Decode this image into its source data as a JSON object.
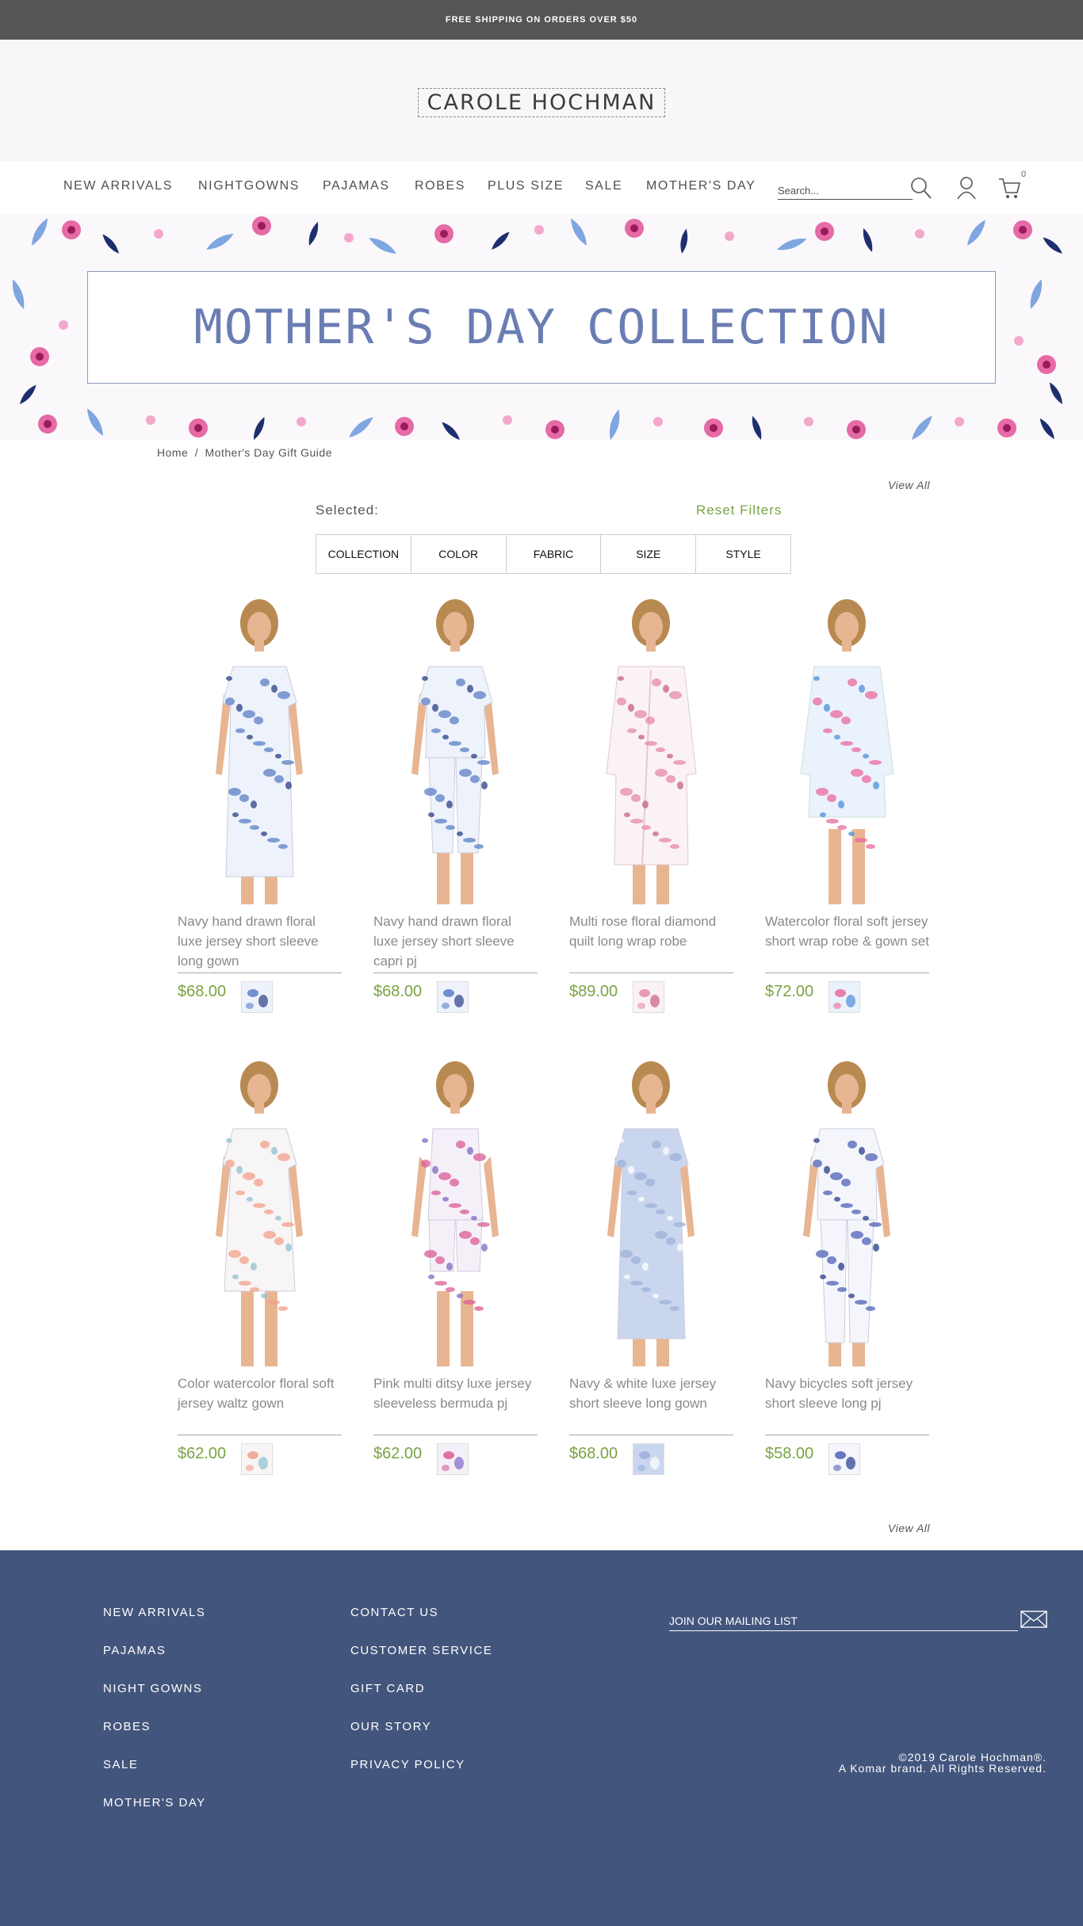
{
  "announcement": "FREE SHIPPING ON ORDERS OVER $50",
  "brand": {
    "logo_text": "CAROLE HOCHMAN"
  },
  "nav": {
    "items": [
      "NEW ARRIVALS",
      "NIGHTGOWNS",
      "PAJAMAS",
      "ROBES",
      "PLUS SIZE",
      "SALE",
      "MOTHER'S DAY"
    ],
    "search_placeholder": "Search...",
    "cart_count": "0"
  },
  "hero": {
    "title": "MOTHER'S DAY COLLECTION"
  },
  "breadcrumb": {
    "home": "Home",
    "separator": "/",
    "current": "Mother's Day Gift Guide"
  },
  "listing": {
    "view_all": "View All",
    "selected_label": "Selected:",
    "reset_filters": "Reset Filters",
    "filters": [
      "COLLECTION",
      "COLOR",
      "FABRIC",
      "SIZE",
      "STYLE"
    ]
  },
  "products": [
    {
      "name": "Navy hand drawn floral luxe jersey short sleeve long gown",
      "price": "$68.00",
      "style": "long gown",
      "print": "blue floral"
    },
    {
      "name": "Navy hand drawn floral luxe jersey short sleeve capri pj",
      "price": "$68.00",
      "style": "capri pj",
      "print": "blue floral"
    },
    {
      "name": "Multi rose floral diamond quilt long wrap robe",
      "price": "$89.00",
      "style": "long robe",
      "print": "pink floral"
    },
    {
      "name": "Watercolor floral soft jersey short wrap robe & gown set",
      "price": "$72.00",
      "style": "short robe",
      "print": "blue pink watercolor"
    },
    {
      "name": "Color watercolor floral soft jersey waltz gown",
      "price": "$62.00",
      "style": "waltz gown",
      "print": "coral watercolor"
    },
    {
      "name": "Pink multi ditsy luxe jersey sleeveless bermuda pj",
      "price": "$62.00",
      "style": "bermuda pj",
      "print": "pink ditsy"
    },
    {
      "name": "Navy & white luxe jersey short sleeve long gown",
      "price": "$68.00",
      "style": "long gown",
      "print": "light blue stripe"
    },
    {
      "name": "Navy bicycles soft jersey short sleeve long pj",
      "price": "$58.00",
      "style": "long pj",
      "print": "navy bicycles"
    }
  ],
  "footer": {
    "col1": [
      "NEW ARRIVALS",
      "PAJAMAS",
      "NIGHT GOWNS",
      "ROBES",
      "SALE",
      "MOTHER'S DAY"
    ],
    "col2": [
      "CONTACT US",
      "CUSTOMER SERVICE",
      "GIFT CARD",
      "OUR STORY",
      "PRIVACY POLICY"
    ],
    "mailing_placeholder": "JOIN OUR MAILING LIST",
    "copyright_line1": "©2019 Carole Hochman®.",
    "copyright_line2": "A Komar brand. All Rights Reserved."
  },
  "colors": {
    "announcement_bg": "#555555",
    "accent_green": "#7aa342",
    "hero_title": "#6a7db3",
    "footer_bg": "#42557c"
  }
}
